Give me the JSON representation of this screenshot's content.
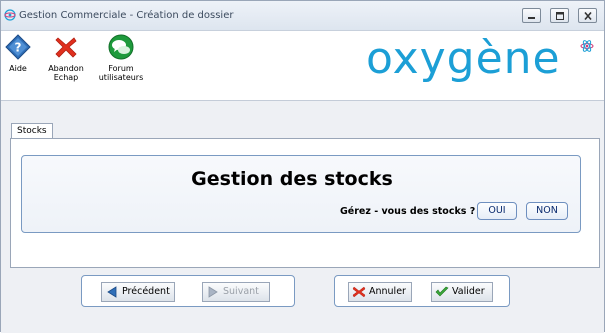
{
  "window": {
    "title": "Gestion Commerciale - Création de dossier",
    "icons": [
      "app-icon",
      "minimize-icon",
      "maximize-icon",
      "close-icon"
    ]
  },
  "toolbar": {
    "help_label": "Aide",
    "abandon_label_line1": "Abandon",
    "abandon_label_line2": "Echap",
    "forum_label_line1": "Forum",
    "forum_label_line2": "utilisateurs",
    "icons": [
      "help-icon",
      "abandon-x-icon",
      "forum-icon"
    ]
  },
  "logo": {
    "text": "oxygène",
    "color": "#1c9fd6"
  },
  "tabs": [
    {
      "label": "Stocks",
      "active": true
    }
  ],
  "stock": {
    "title": "Gestion des stocks",
    "question": "Gérez - vous des stocks ?",
    "yes_label": "OUI",
    "no_label": "NON"
  },
  "navigation": {
    "prev_label": "Précédent",
    "next_label": "Suivant",
    "next_enabled": false,
    "cancel_label": "Annuler",
    "validate_label": "Valider",
    "icons": [
      "arrow-left-icon",
      "arrow-right-icon",
      "cancel-x-icon",
      "check-icon"
    ]
  }
}
